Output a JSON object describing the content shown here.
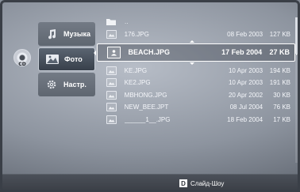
{
  "disc": {
    "label": "CD",
    "icon": "cd-disc-icon"
  },
  "sidebar": {
    "items": [
      {
        "label": "Музыка",
        "icon": "music-note-icon",
        "state": "normal"
      },
      {
        "label": "Фото",
        "icon": "photo-icon",
        "state": "active"
      },
      {
        "label": "Настр.",
        "icon": "gear-icon",
        "state": "normal"
      }
    ]
  },
  "files": {
    "parent": {
      "name": "..",
      "icon": "folder-up-icon"
    },
    "rows": [
      {
        "name": "176.JPG",
        "date": "08 Feb 2003",
        "size": "127 KB",
        "icon": "image-file-icon"
      },
      {
        "name": "BEACH.JPG",
        "date": "17 Feb 2004",
        "size": "27 KB",
        "icon": "image-file-icon",
        "selected": true
      },
      {
        "name": "KE.JPG",
        "date": "10 Apr 2003",
        "size": "194 KB",
        "icon": "image-file-icon"
      },
      {
        "name": "KE2.JPG",
        "date": "10 Apr 2003",
        "size": "191 KB",
        "icon": "image-file-icon"
      },
      {
        "name": "MBHONG.JPG",
        "date": "20 Apr 2002",
        "size": "30 KB",
        "icon": "image-file-icon"
      },
      {
        "name": "NEW_BEE.JPT",
        "date": "08 Jul 2004",
        "size": "76 KB",
        "icon": "image-file-icon"
      },
      {
        "name": "______1__.JPG",
        "date": "18 Feb 2004",
        "size": "17 KB",
        "icon": "image-file-icon"
      }
    ]
  },
  "footer": {
    "key": "D",
    "label": "Слайд-Шоу"
  },
  "colors": {
    "selection_border": "#ffffff",
    "footer_bg": "#3f444b",
    "text": "#ffffff"
  }
}
